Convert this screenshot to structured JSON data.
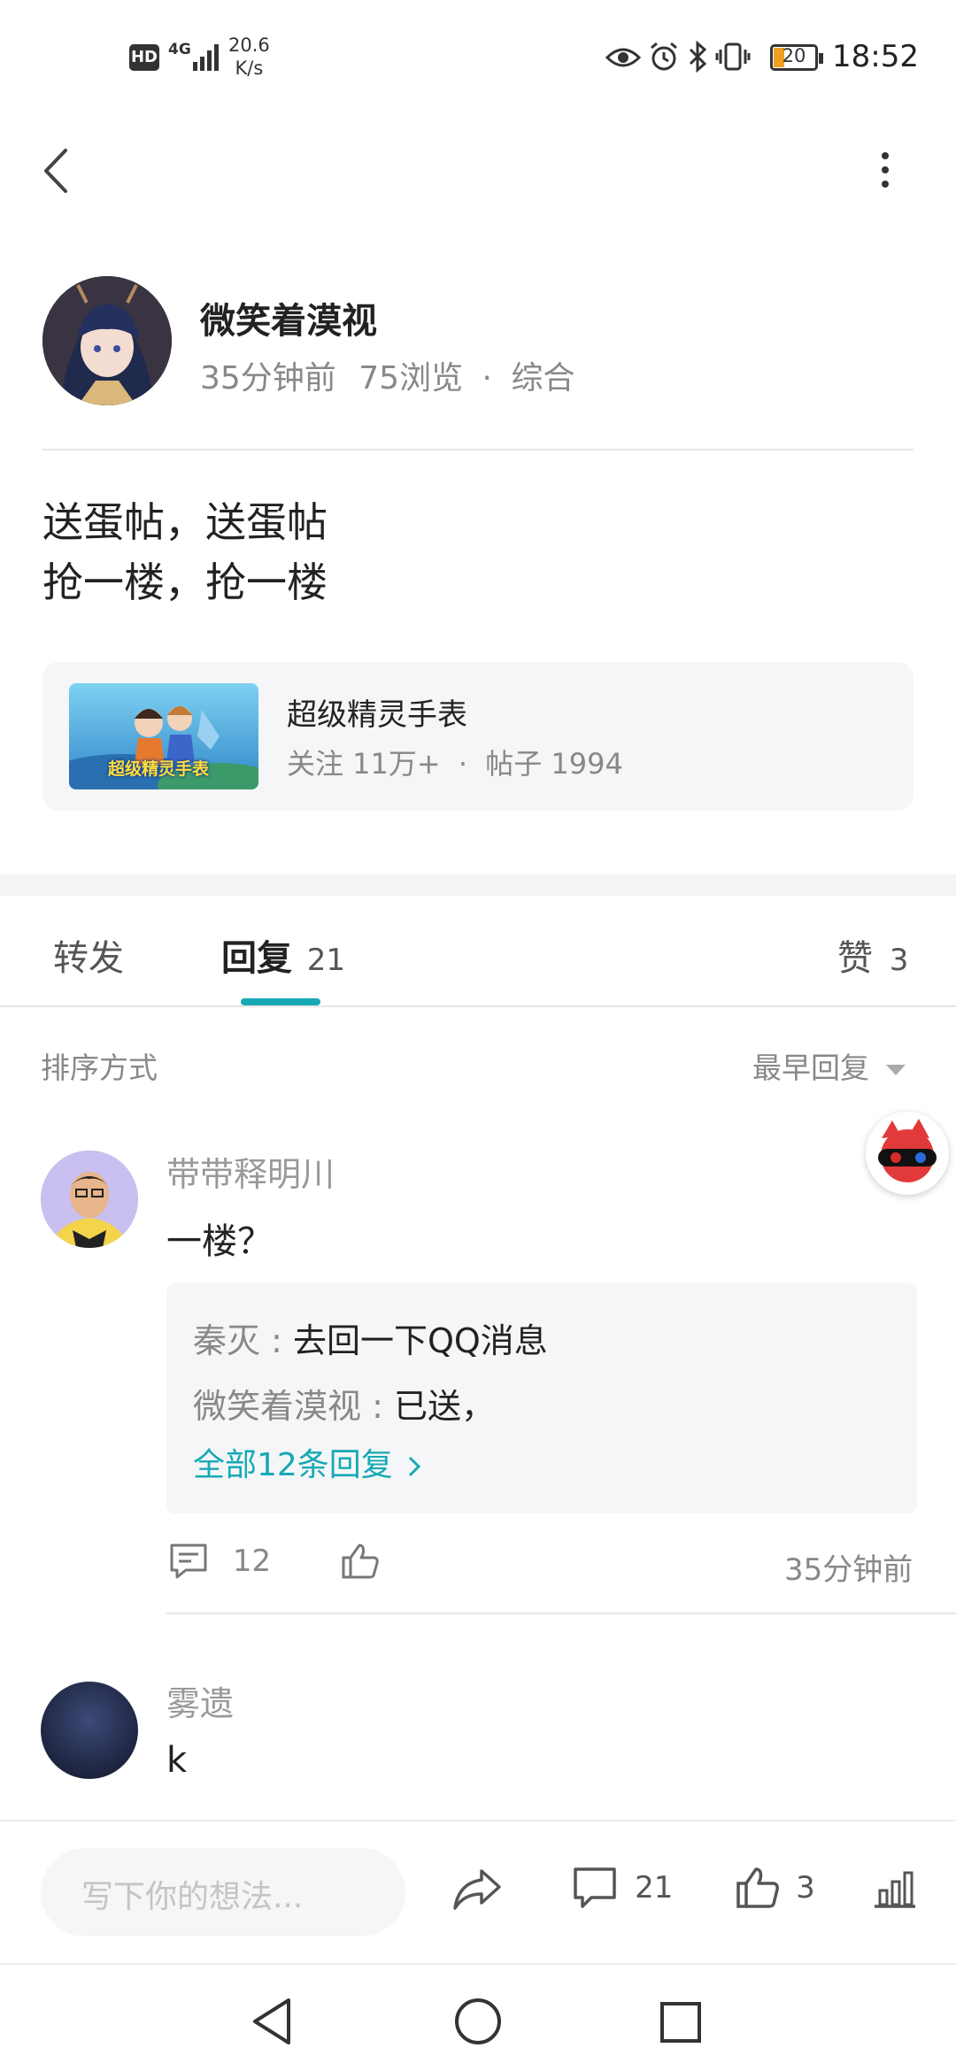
{
  "status_bar": {
    "hd": "HD",
    "network": "4G",
    "speed_value": "20.6",
    "speed_unit": "K/s",
    "battery": "20",
    "time": "18:52"
  },
  "post": {
    "author": "微笑着漠视",
    "time_ago": "35分钟前",
    "views": "75浏览",
    "separator": "·",
    "category": "综合",
    "line1": "送蛋帖，送蛋帖",
    "line2": "抢一楼，抢一楼"
  },
  "game_card": {
    "name": "超级精灵手表",
    "followers": "关注 11万+",
    "separator": "·",
    "posts": "帖子 1994",
    "thumb_text": "超级精灵手表"
  },
  "tabs": {
    "repost": "转发",
    "reply": "回复",
    "reply_count": "21",
    "like_label": "赞",
    "like_count": "3"
  },
  "sort": {
    "label": "排序方式",
    "value": "最早回复"
  },
  "comments": [
    {
      "user": "带带释明川",
      "text": "一楼？",
      "replies": [
        {
          "user": "秦灭",
          "sep": " : ",
          "text": "去回一下QQ消息"
        },
        {
          "user": "微笑着漠视",
          "sep": " : ",
          "text": "已送，"
        }
      ],
      "all_replies": "全部12条回复",
      "comment_count": "12",
      "time": "35分钟前"
    },
    {
      "user": "雾遗",
      "text": "k"
    }
  ],
  "bottom_bar": {
    "placeholder": "写下你的想法...",
    "comment_count": "21",
    "like_count": "3"
  },
  "colors": {
    "accent": "#17a9b5",
    "text_primary": "#222222",
    "text_secondary": "#888888",
    "card_bg": "#f5f6f7"
  }
}
